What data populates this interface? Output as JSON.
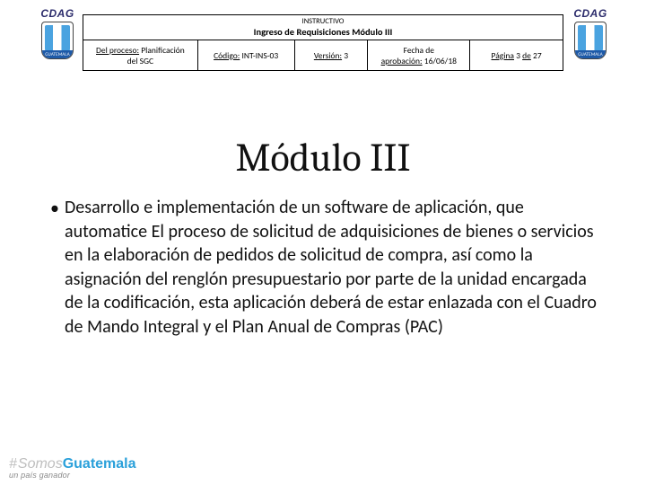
{
  "logo": {
    "word": "CDAG",
    "band": "GUATEMALA"
  },
  "table": {
    "top_small": "INSTRUCTIVO",
    "top_bold": "Ingreso de Requisiciones Módulo III",
    "cells": {
      "proceso_l1": "Del proceso:",
      "proceso_l2": "Planificación",
      "proceso_l3": "del SGC",
      "codigo_lbl": "Código:",
      "codigo_val": "INT-INS-03",
      "version_lbl": "Versión:",
      "version_val": "3",
      "fecha_l1": "Fecha de",
      "fecha_l2_lbl": "aprobación:",
      "fecha_l2_val": "16/06/18",
      "pagina_lbl": "Página",
      "pagina_cur": "3",
      "pagina_de": "de",
      "pagina_tot": "27"
    }
  },
  "title": "Módulo III",
  "bullet": "•",
  "body": "Desarrollo e implementación de  un software de aplicación, que automatice El proceso de solicitud de adquisiciones de bienes o servicios en la elaboración de pedidos de solicitud de compra, así como la asignación del renglón presupuestario por parte de la unidad encargada de la codificación, esta aplicación deberá de estar enlazada con el Cuadro de Mando Integral  y el Plan Anual de Compras (PAC)",
  "footer": {
    "hash": "#",
    "somos": "Somos",
    "gua": "Guatemala",
    "sub": "un país ganador"
  }
}
